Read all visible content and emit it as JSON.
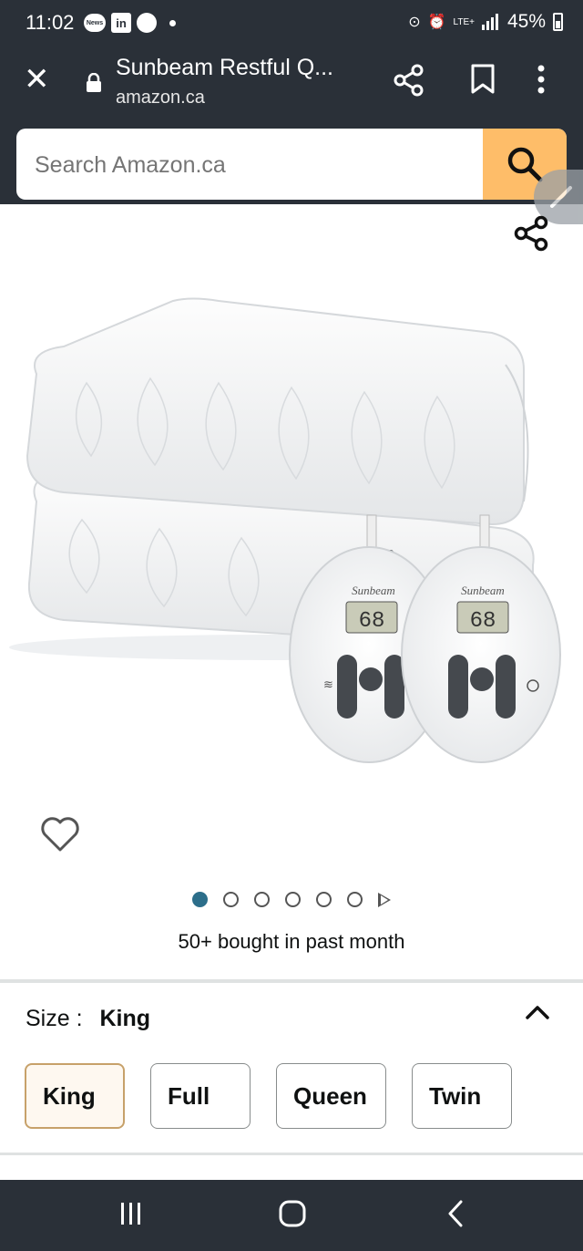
{
  "status_bar": {
    "time": "11:02",
    "notif_news": "News",
    "notif_linkedin": "in",
    "network": "LTE+",
    "battery": "45%"
  },
  "browser": {
    "page_title": "Sunbeam Restful Q...",
    "url": "amazon.ca"
  },
  "search": {
    "placeholder": "Search Amazon.ca"
  },
  "product": {
    "controller_brand": "Sunbeam",
    "controller_display": "68",
    "carousel": {
      "total_images": 6,
      "active_index": 0
    },
    "bought_text": "50+ bought in past month"
  },
  "size_selector": {
    "label": "Size :",
    "selected": "King",
    "options": [
      "King",
      "Full",
      "Queen",
      "Twin"
    ]
  },
  "colors": {
    "chrome_bg": "#2a3038",
    "search_button": "#febd69",
    "carousel_active": "#2c6e8a",
    "selected_border": "#c7a16a"
  },
  "icons": [
    "close-icon",
    "lock-icon",
    "share-icon",
    "bookmark-icon",
    "more-vert-icon",
    "search-icon",
    "heart-icon",
    "chevron-up-icon",
    "recents-icon",
    "home-icon",
    "back-icon"
  ]
}
